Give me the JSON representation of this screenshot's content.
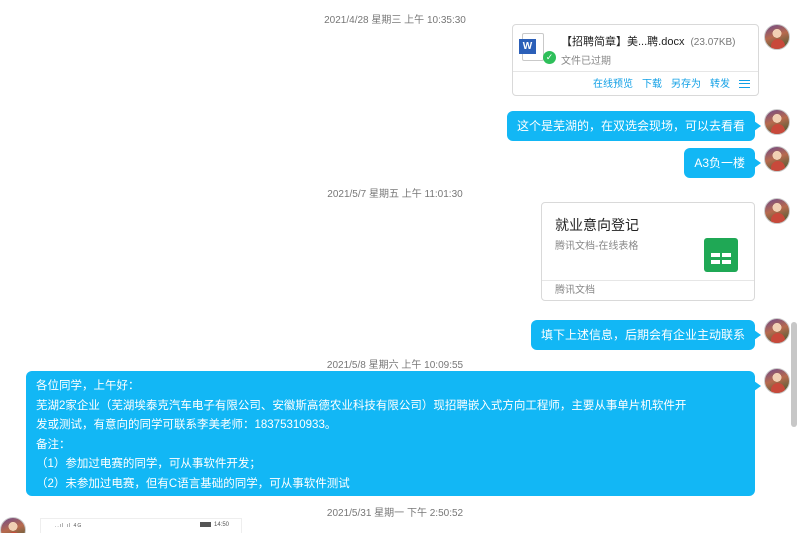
{
  "timestamps": {
    "t1": "2021/4/28 星期三 上午 10:35:30",
    "t2": "2021/5/7 星期五 上午 11:01:30",
    "t3": "2021/5/8 星期六 上午 10:09:55",
    "t4": "2021/5/31 星期一 下午 2:50:52"
  },
  "file_message": {
    "icon": "word-doc-icon",
    "name": "【招聘简章】美...聘.docx",
    "size": "(23.07KB)",
    "status": "文件已过期",
    "actions": [
      "在线预览",
      "下载",
      "另存为",
      "转发"
    ],
    "menu_icon": "menu-icon"
  },
  "messages": {
    "m1": "这个是芜湖的，在双选会现场，可以去看看",
    "m2": "A3负一楼",
    "m3": "填下上述信息，后期会有企业主动联系"
  },
  "doc_card": {
    "title": "就业意向登记",
    "subtitle": "腾讯文档-在线表格",
    "icon": "spreadsheet-icon",
    "footer": "腾讯文档"
  },
  "announcement": {
    "lines": [
      "各位同学，上午好：",
      "芜湖2家企业（芜湖埃泰克汽车电子有限公司、安徽斯高德农业科技有限公司）现招聘嵌入式方向工程师，主要从事单片机软件开",
      "发或测试，有意向的同学可联系李美老师：18375310933。",
      "备注：",
      "（1）参加过电赛的同学，可从事软件开发；",
      "（2）未参加过电赛，但有C语言基础的同学，可从事软件测试"
    ]
  },
  "phone_preview": {
    "status_left": "..ıl ıl 4G",
    "time": "14:50"
  },
  "colors": {
    "bubble": "#12b7f5",
    "link": "#12a0e6",
    "sheet_green": "#1fa855",
    "word_blue": "#2b5fb8"
  }
}
